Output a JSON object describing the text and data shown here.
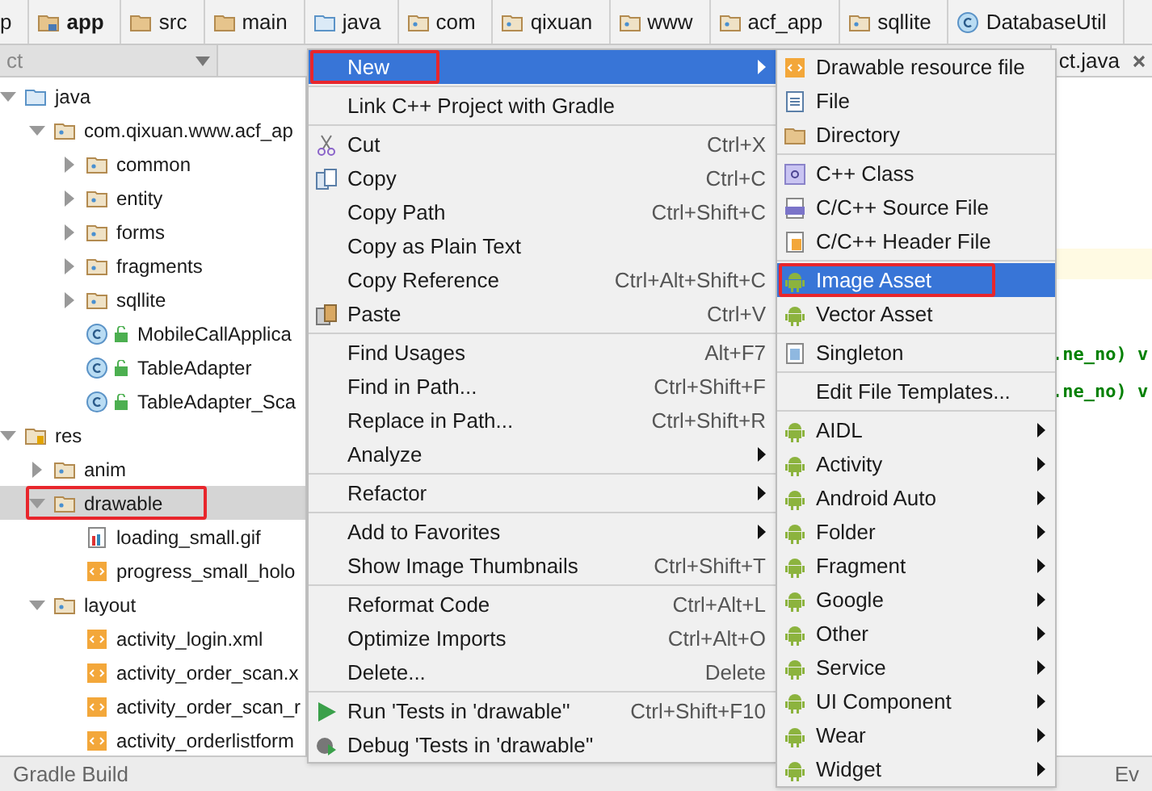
{
  "breadcrumbs": [
    {
      "label": "p",
      "kind": "plain",
      "bold": false
    },
    {
      "label": "app",
      "kind": "module",
      "bold": true
    },
    {
      "label": "src",
      "kind": "folder",
      "bold": false
    },
    {
      "label": "main",
      "kind": "folder",
      "bold": false
    },
    {
      "label": "java",
      "kind": "source",
      "bold": false
    },
    {
      "label": "com",
      "kind": "package",
      "bold": false
    },
    {
      "label": "qixuan",
      "kind": "package",
      "bold": false
    },
    {
      "label": "www",
      "kind": "package",
      "bold": false
    },
    {
      "label": "acf_app",
      "kind": "package",
      "bold": false
    },
    {
      "label": "sqllite",
      "kind": "package",
      "bold": false
    },
    {
      "label": "DatabaseUtil",
      "kind": "class",
      "bold": false
    }
  ],
  "project_panel": {
    "title": "ct"
  },
  "editor_tab": {
    "label": "ct.java"
  },
  "tree": [
    {
      "label": "java",
      "kind": "source",
      "expanded": true,
      "selected": false,
      "outlined": false,
      "children": [
        {
          "label": "com.qixuan.www.acf_ap",
          "kind": "package",
          "expanded": true,
          "selected": false,
          "outlined": false,
          "children": [
            {
              "label": "common",
              "kind": "package",
              "expanded": false,
              "selected": false,
              "outlined": false
            },
            {
              "label": "entity",
              "kind": "package",
              "expanded": false,
              "selected": false,
              "outlined": false
            },
            {
              "label": "forms",
              "kind": "package",
              "expanded": false,
              "selected": false,
              "outlined": false
            },
            {
              "label": "fragments",
              "kind": "package",
              "expanded": false,
              "selected": false,
              "outlined": false
            },
            {
              "label": "sqllite",
              "kind": "package",
              "expanded": false,
              "selected": false,
              "outlined": false
            },
            {
              "label": "MobileCallApplica",
              "kind": "class",
              "selected": false,
              "outlined": false
            },
            {
              "label": "TableAdapter",
              "kind": "class",
              "selected": false,
              "outlined": false
            },
            {
              "label": "TableAdapter_Sca",
              "kind": "class",
              "selected": false,
              "outlined": false
            }
          ]
        }
      ]
    },
    {
      "label": "res",
      "kind": "res",
      "expanded": true,
      "selected": false,
      "outlined": false,
      "children": [
        {
          "label": "anim",
          "kind": "package",
          "expanded": false,
          "selected": false,
          "outlined": false
        },
        {
          "label": "drawable",
          "kind": "package",
          "expanded": true,
          "selected": true,
          "outlined": true,
          "children": [
            {
              "label": "loading_small.gif",
              "kind": "image",
              "selected": false,
              "outlined": false
            },
            {
              "label": "progress_small_holo",
              "kind": "xml",
              "selected": false,
              "outlined": false
            }
          ]
        },
        {
          "label": "layout",
          "kind": "package",
          "expanded": true,
          "selected": false,
          "outlined": false,
          "children": [
            {
              "label": "activity_login.xml",
              "kind": "xml",
              "selected": false,
              "outlined": false
            },
            {
              "label": "activity_order_scan.x",
              "kind": "xml",
              "selected": false,
              "outlined": false
            },
            {
              "label": "activity_order_scan_r",
              "kind": "xml",
              "selected": false,
              "outlined": false
            },
            {
              "label": "activity_orderlistform",
              "kind": "xml",
              "selected": false,
              "outlined": false
            }
          ]
        }
      ]
    }
  ],
  "code_lines": [
    ".ne_no) v",
    ".ne_no) v"
  ],
  "bottom_bar": {
    "left": "Gradle Build",
    "right": "Ev"
  },
  "context_menu": [
    {
      "kind": "plain",
      "label": "New",
      "submenu": true,
      "selected": true,
      "outlined": true
    },
    {
      "kind": "separator"
    },
    {
      "kind": "plain",
      "label": "Link C++ Project with Gradle",
      "submenu": false,
      "selected": false,
      "outlined": false
    },
    {
      "kind": "separator"
    },
    {
      "kind": "cut",
      "label": "Cut",
      "shortcut": "Ctrl+X",
      "submenu": false,
      "selected": false,
      "outlined": false
    },
    {
      "kind": "copy",
      "label": "Copy",
      "shortcut": "Ctrl+C",
      "submenu": false,
      "selected": false,
      "outlined": false
    },
    {
      "kind": "plain",
      "label": "Copy Path",
      "shortcut": "Ctrl+Shift+C",
      "submenu": false,
      "selected": false,
      "outlined": false
    },
    {
      "kind": "plain",
      "label": "Copy as Plain Text",
      "submenu": false,
      "selected": false,
      "outlined": false
    },
    {
      "kind": "plain",
      "label": "Copy Reference",
      "shortcut": "Ctrl+Alt+Shift+C",
      "submenu": false,
      "selected": false,
      "outlined": false
    },
    {
      "kind": "paste",
      "label": "Paste",
      "shortcut": "Ctrl+V",
      "submenu": false,
      "selected": false,
      "outlined": false
    },
    {
      "kind": "separator"
    },
    {
      "kind": "plain",
      "label": "Find Usages",
      "shortcut": "Alt+F7",
      "submenu": false,
      "selected": false,
      "outlined": false
    },
    {
      "kind": "plain",
      "label": "Find in Path...",
      "shortcut": "Ctrl+Shift+F",
      "submenu": false,
      "selected": false,
      "outlined": false
    },
    {
      "kind": "plain",
      "label": "Replace in Path...",
      "shortcut": "Ctrl+Shift+R",
      "submenu": false,
      "selected": false,
      "outlined": false
    },
    {
      "kind": "plain",
      "label": "Analyze",
      "submenu": true,
      "selected": false,
      "outlined": false
    },
    {
      "kind": "separator"
    },
    {
      "kind": "plain",
      "label": "Refactor",
      "submenu": true,
      "selected": false,
      "outlined": false
    },
    {
      "kind": "separator"
    },
    {
      "kind": "plain",
      "label": "Add to Favorites",
      "submenu": true,
      "selected": false,
      "outlined": false
    },
    {
      "kind": "plain",
      "label": "Show Image Thumbnails",
      "shortcut": "Ctrl+Shift+T",
      "submenu": false,
      "selected": false,
      "outlined": false
    },
    {
      "kind": "separator"
    },
    {
      "kind": "plain",
      "label": "Reformat Code",
      "shortcut": "Ctrl+Alt+L",
      "submenu": false,
      "selected": false,
      "outlined": false
    },
    {
      "kind": "plain",
      "label": "Optimize Imports",
      "shortcut": "Ctrl+Alt+O",
      "submenu": false,
      "selected": false,
      "outlined": false
    },
    {
      "kind": "plain",
      "label": "Delete...",
      "shortcut": "Delete",
      "submenu": false,
      "selected": false,
      "outlined": false
    },
    {
      "kind": "separator"
    },
    {
      "kind": "run",
      "label": "Run 'Tests in 'drawable''",
      "shortcut": "Ctrl+Shift+F10",
      "submenu": false,
      "selected": false,
      "outlined": false
    },
    {
      "kind": "debug",
      "label": "Debug 'Tests in 'drawable''",
      "submenu": false,
      "selected": false,
      "outlined": false
    }
  ],
  "new_submenu": [
    {
      "kind": "xml",
      "label": "Drawable resource file",
      "submenu": false,
      "selected": false,
      "outlined": false
    },
    {
      "kind": "file",
      "label": "File",
      "submenu": false,
      "selected": false,
      "outlined": false
    },
    {
      "kind": "folder",
      "label": "Directory",
      "submenu": false,
      "selected": false,
      "outlined": false
    },
    {
      "kind": "separator"
    },
    {
      "kind": "cppclass",
      "label": "C++ Class",
      "submenu": false,
      "selected": false,
      "outlined": false
    },
    {
      "kind": "cppsource",
      "label": "C/C++ Source File",
      "submenu": false,
      "selected": false,
      "outlined": false
    },
    {
      "kind": "header",
      "label": "C/C++ Header File",
      "submenu": false,
      "selected": false,
      "outlined": false
    },
    {
      "kind": "separator"
    },
    {
      "kind": "android",
      "label": "Image Asset",
      "submenu": false,
      "selected": true,
      "outlined": true
    },
    {
      "kind": "android",
      "label": "Vector Asset",
      "submenu": false,
      "selected": false,
      "outlined": false
    },
    {
      "kind": "separator"
    },
    {
      "kind": "singleton",
      "label": "Singleton",
      "submenu": false,
      "selected": false,
      "outlined": false
    },
    {
      "kind": "separator"
    },
    {
      "kind": "plain",
      "label": "Edit File Templates...",
      "submenu": false,
      "selected": false,
      "outlined": false
    },
    {
      "kind": "separator"
    },
    {
      "kind": "android",
      "label": "AIDL",
      "submenu": true,
      "selected": false,
      "outlined": false
    },
    {
      "kind": "android",
      "label": "Activity",
      "submenu": true,
      "selected": false,
      "outlined": false
    },
    {
      "kind": "android",
      "label": "Android Auto",
      "submenu": true,
      "selected": false,
      "outlined": false
    },
    {
      "kind": "android",
      "label": "Folder",
      "submenu": true,
      "selected": false,
      "outlined": false
    },
    {
      "kind": "android",
      "label": "Fragment",
      "submenu": true,
      "selected": false,
      "outlined": false
    },
    {
      "kind": "android",
      "label": "Google",
      "submenu": true,
      "selected": false,
      "outlined": false
    },
    {
      "kind": "android",
      "label": "Other",
      "submenu": true,
      "selected": false,
      "outlined": false
    },
    {
      "kind": "android",
      "label": "Service",
      "submenu": true,
      "selected": false,
      "outlined": false
    },
    {
      "kind": "android",
      "label": "UI Component",
      "submenu": true,
      "selected": false,
      "outlined": false
    },
    {
      "kind": "android",
      "label": "Wear",
      "submenu": true,
      "selected": false,
      "outlined": false
    },
    {
      "kind": "android",
      "label": "Widget",
      "submenu": true,
      "selected": false,
      "outlined": false
    }
  ]
}
